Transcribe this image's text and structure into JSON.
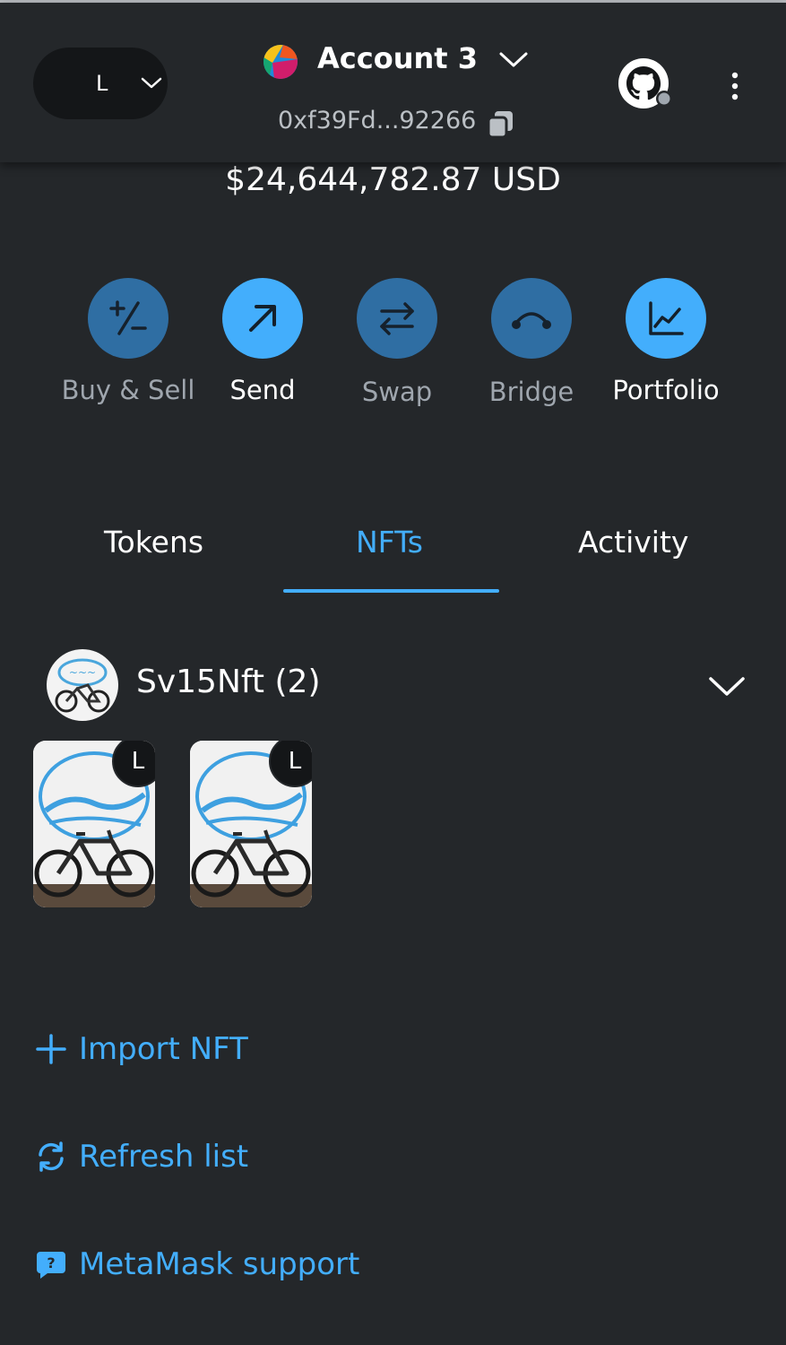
{
  "header": {
    "network_letter": "L",
    "account_name": "Account 3",
    "address": "0xf39Fd...92266",
    "network_menu_icon": "chevron-down-icon",
    "account_menu_icon": "chevron-down-icon",
    "copy_icon": "copy-icon",
    "profile_icon": "github-icon",
    "menu_icon": "kebab-menu-icon"
  },
  "balance": "$24,644,782.87 USD",
  "actions": [
    {
      "label": "Buy & Sell",
      "icon": "plus-minus-icon",
      "enabled": false
    },
    {
      "label": "Send",
      "icon": "arrow-up-right-icon",
      "enabled": true
    },
    {
      "label": "Swap",
      "icon": "swap-arrows-icon",
      "enabled": false
    },
    {
      "label": "Bridge",
      "icon": "bridge-icon",
      "enabled": false
    },
    {
      "label": "Portfolio",
      "icon": "chart-line-icon",
      "enabled": true
    }
  ],
  "tabs": [
    {
      "label": "Tokens",
      "active": false
    },
    {
      "label": "NFTs",
      "active": true
    },
    {
      "label": "Activity",
      "active": false
    }
  ],
  "collection": {
    "name": "Sv15Nft (2)",
    "items": [
      {
        "network_badge": "L"
      },
      {
        "network_badge": "L"
      }
    ]
  },
  "links": {
    "import_nft": "Import NFT",
    "refresh_list": "Refresh list",
    "support": "MetaMask support"
  },
  "colors": {
    "background": "#24272a",
    "accent": "#43aefc",
    "accent_dim": "#2f6ea3",
    "muted_text": "#9fa6ae"
  }
}
